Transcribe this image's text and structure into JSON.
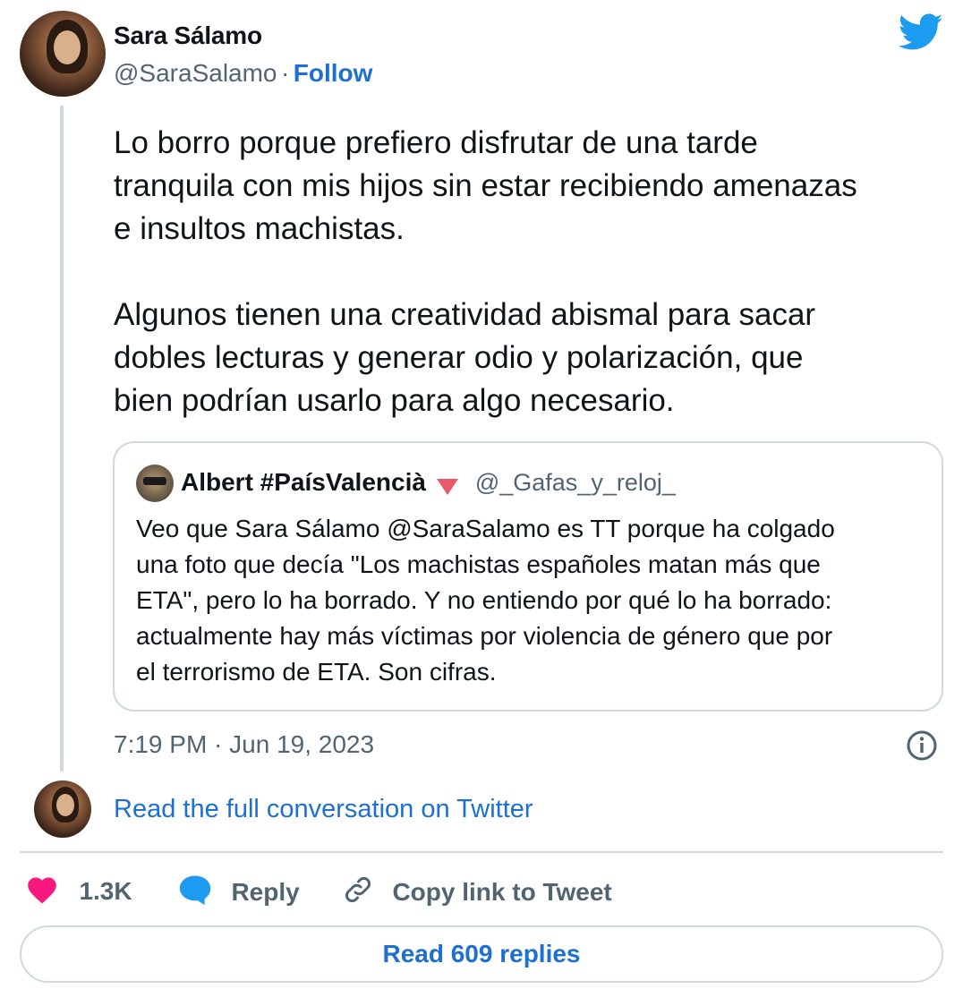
{
  "tweet": {
    "author_name": "Sara Sálamo",
    "author_handle": "@SaraSalamo",
    "separator": "·",
    "follow_label": "Follow",
    "paragraph1": "Lo borro porque prefiero disfrutar de una tarde\ntranquila con mis hijos sin estar recibiendo amenazas\ne insultos machistas.",
    "paragraph2": "Algunos tienen una creatividad abismal para sacar\ndobles lecturas y generar odio y polarización, que\nbien podrían usarlo para algo necesario.",
    "timestamp": "7:19 PM · Jun 19, 2023"
  },
  "quote": {
    "author_name": "Albert #PaísValencià",
    "flag_emoji": "🔻",
    "author_handle": "@_Gafas_y_reloj_",
    "text_lines": [
      "Veo que Sara Sálamo @SaraSalamo es TT porque ha colgado",
      "una foto que decía \"Los machistas españoles matan más que",
      "ETA\", pero lo ha borrado. Y no entiendo por qué lo ha borrado:",
      "actualmente hay más víctimas por violencia de género que por",
      "el terrorismo de ETA. Son cifras."
    ]
  },
  "conversation_link": "Read the full conversation on Twitter",
  "actions": {
    "like_count": "1.3K",
    "reply_label": "Reply",
    "copy_label": "Copy link to Tweet"
  },
  "read_replies_label": "Read 609 replies",
  "colors": {
    "twitter_blue": "#1d9bf0",
    "link_blue": "#1d6fd1",
    "heart": "#f91880",
    "gray": "#536471"
  }
}
